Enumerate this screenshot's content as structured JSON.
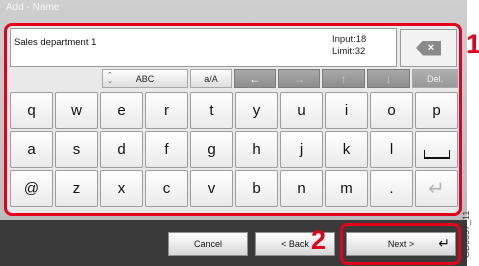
{
  "title": "Add - Name",
  "input": {
    "value": "Sales department 1",
    "count_label": "Input:18",
    "limit_label": "Limit:32"
  },
  "backspace": {
    "label": "×",
    "icon": "backspace-icon"
  },
  "controls": {
    "mode_label": "ABC",
    "case_label": "a/A",
    "left_arrow": "←",
    "right_arrow": "→",
    "up_arrow": "↑",
    "down_arrow": "↓",
    "del_label": "Del."
  },
  "rows": [
    [
      "q",
      "w",
      "e",
      "r",
      "t",
      "y",
      "u",
      "i",
      "o",
      "p"
    ],
    [
      "a",
      "s",
      "d",
      "f",
      "g",
      "h",
      "j",
      "k",
      "l"
    ],
    [
      "@",
      "z",
      "x",
      "c",
      "v",
      "b",
      "n",
      "m",
      "."
    ]
  ],
  "buttons": {
    "cancel": "Cancel",
    "back": "< Back",
    "next": "Next >"
  },
  "callouts": {
    "first": "1",
    "second": "2"
  },
  "figure_code": "GB0057_11",
  "colors": {
    "highlight": "#e3001b",
    "bar": "#3a3a3a"
  }
}
